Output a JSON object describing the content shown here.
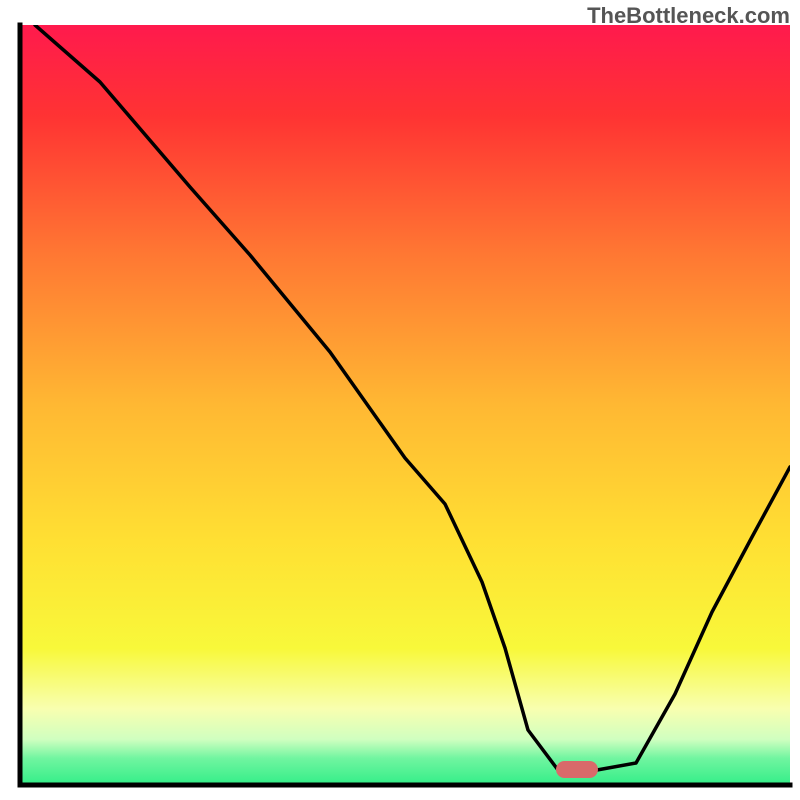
{
  "watermark": "TheBottleneck.com",
  "chart_data": {
    "type": "line",
    "title": "",
    "xlabel": "",
    "ylabel": "",
    "xlim": [
      0,
      100
    ],
    "ylim": [
      0,
      100
    ],
    "x": [
      2,
      10,
      22,
      30,
      40,
      50,
      55,
      60,
      63,
      66,
      70,
      75,
      80,
      85,
      90,
      95,
      100
    ],
    "values": [
      100,
      93,
      79,
      70,
      57,
      43,
      37,
      27,
      18,
      7,
      2,
      2,
      3,
      12,
      23,
      33,
      42
    ],
    "marker": {
      "x": 68,
      "y": 2.5,
      "color": "#d96a6a"
    },
    "gradient_bands": [
      {
        "y_start": 100,
        "y_end": 80,
        "color_top": "#ff1a4d",
        "color_bottom": "#ff5533"
      },
      {
        "y_start": 80,
        "y_end": 55,
        "color_top": "#ff5533",
        "color_bottom": "#ffa033"
      },
      {
        "y_start": 55,
        "y_end": 35,
        "color_top": "#ffa033",
        "color_bottom": "#ffd633"
      },
      {
        "y_start": 35,
        "y_end": 15,
        "color_top": "#ffd633",
        "color_bottom": "#f5f533"
      },
      {
        "y_start": 15,
        "y_end": 8,
        "color_top": "#f5f533",
        "color_bottom": "#faffaa"
      },
      {
        "y_start": 8,
        "y_end": 3,
        "color_top": "#faffaa",
        "color_bottom": "#a0ffb0"
      },
      {
        "y_start": 3,
        "y_end": 0,
        "color_top": "#33ee88",
        "color_bottom": "#33ee88"
      }
    ],
    "border_color": "#000000"
  }
}
